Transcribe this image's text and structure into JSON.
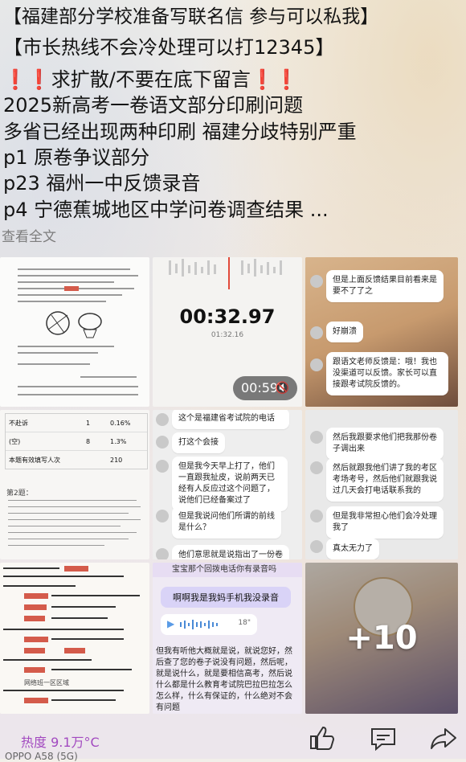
{
  "post": {
    "line1": "【福建部分学校准备写联名信 参与可以私我】",
    "line2": "【市长热线不会冷处理可以打12345】",
    "line3_prefix": "❗❗",
    "line3_text": "求扩散/不要在底下留言",
    "line3_suffix": "❗❗",
    "line4": "2025新高考一卷语文部分印刷问题",
    "line5": "多省已经出现两种印刷 福建分歧特别严重",
    "line6": "p1  原卷争议部分",
    "line7": "p23 福州一中反馈录音",
    "line8": "p4  宁德蕉城地区中学问卷调查结果 ...",
    "expand": "查看全文"
  },
  "images": {
    "recording": {
      "timer": "00:32.97",
      "subtimer": "01:32.16",
      "duration": "00:59"
    },
    "chat3": {
      "msg1": "但是上面反馈结果目前看来是要不了了之",
      "msg2": "好崩溃",
      "msg3": "跟语文老师反馈是：哦！我也没渠道可以反馈。家长可以直接跟考试院反馈的。"
    },
    "table4": {
      "rows": [
        {
          "label": "不赴诉",
          "n": "1",
          "pct": "0.16%"
        },
        {
          "label": "(空)",
          "n": "8",
          "pct": "1.3%"
        },
        {
          "label": "本题有效填写人次",
          "n": "",
          "pct": "210"
        }
      ],
      "section": "第2题："
    },
    "chat5": {
      "msg1": "这个是福建省考试院的电话",
      "msg2": "打这个会接",
      "msg3": "但是我今天早上打了，他们一直跟我扯皮，说前两天已经有人反应过这个问题了，说他们已经备案过了",
      "msg4": "但是我说问他们所谓的前线是什么？",
      "msg5": "他们意思就是说指出了一份卷"
    },
    "chat6": {
      "msg1": "然后我跟要求他们把我那份卷子调出来",
      "msg2": "然后就跟我他们讲了我的考区考场考号，然后他们就跟我说过几天会打电话联系我的",
      "msg3": "但是我非常担心他们会冷处理我了",
      "msg4": "真太无力了"
    },
    "chat7": {
      "label": "网络班一区区域"
    },
    "chat8": {
      "banner": "宝宝那个回拨电话你有录音吗",
      "reply": "啊啊我是我妈手机我没录音",
      "voice_len": "18\"",
      "long_msg": "但我有听他大概就是说，就说您好，然后查了您的卷子说没有问题，然后呢，就是说什么，就是要相信高考，然后说什么都是什么教育考试院巴拉巴拉怎么怎么样，什么有保证的，什么绝对不会有问题"
    },
    "more": {
      "label": "+10"
    }
  },
  "footer": {
    "heat": "热度 9.1万°C",
    "device": "OPPO A58 (5G)"
  },
  "colors": {
    "warn": "#d3271f",
    "heat": "#a24ac0",
    "expand": "#7d7d7d"
  }
}
